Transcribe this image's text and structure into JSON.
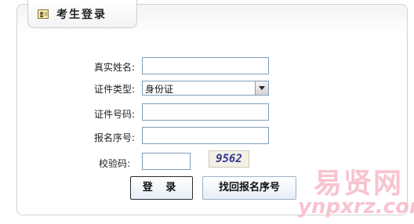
{
  "header": {
    "title": "考生登录",
    "icon": "user-card-icon"
  },
  "form": {
    "name_label": "真实姓名:",
    "name_value": "",
    "id_type_label": "证件类型:",
    "id_type_value": "身份证",
    "id_number_label": "证件号码:",
    "id_number_value": "",
    "reg_number_label": "报名序号:",
    "reg_number_value": "",
    "captcha_label": "校验码:",
    "captcha_value": "",
    "captcha_code": "9562"
  },
  "buttons": {
    "login": "登 录",
    "find": "找回报名序号"
  },
  "watermark": {
    "cn": "易贤网",
    "en": "ynpxrz.com"
  },
  "colors": {
    "border": "#7f9db9",
    "captcha_text": "#36378f",
    "watermark": "#f7b9c8"
  }
}
